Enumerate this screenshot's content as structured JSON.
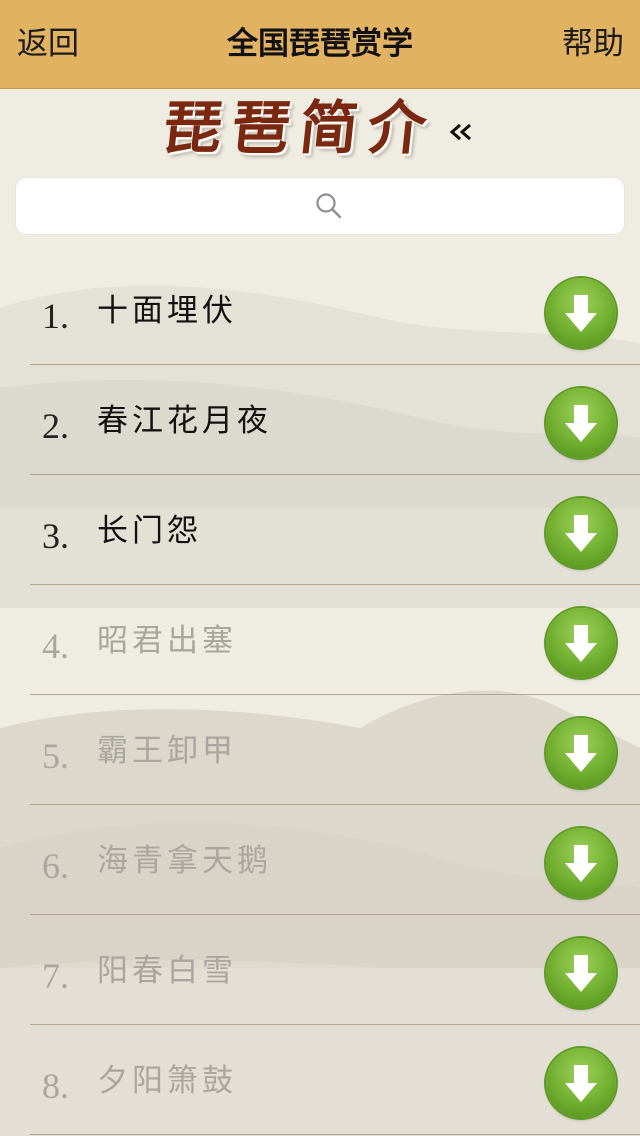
{
  "navbar": {
    "back_label": "返回",
    "title": "全国琵琶赏学",
    "help_label": "帮助"
  },
  "section": {
    "title": "琵琶简介",
    "collapse_icon": "double-chevron-left-icon"
  },
  "search": {
    "value": "",
    "placeholder": "",
    "icon": "search-icon"
  },
  "list": [
    {
      "number": "1.",
      "name": "十面埋伏",
      "enabled": true
    },
    {
      "number": "2.",
      "name": "春江花月夜",
      "enabled": true
    },
    {
      "number": "3.",
      "name": "长门怨",
      "enabled": true
    },
    {
      "number": "4.",
      "name": "昭君出塞",
      "enabled": false
    },
    {
      "number": "5.",
      "name": "霸王卸甲",
      "enabled": false
    },
    {
      "number": "6.",
      "name": "海青拿天鹅",
      "enabled": false
    },
    {
      "number": "7.",
      "name": "阳春白雪",
      "enabled": false
    },
    {
      "number": "8.",
      "name": "夕阳箫鼓",
      "enabled": false
    }
  ],
  "colors": {
    "navbar": "#e1b262",
    "title_ink": "#7a2810",
    "download_green": "#6fae2e",
    "disabled_text": "#a9a6a0"
  }
}
